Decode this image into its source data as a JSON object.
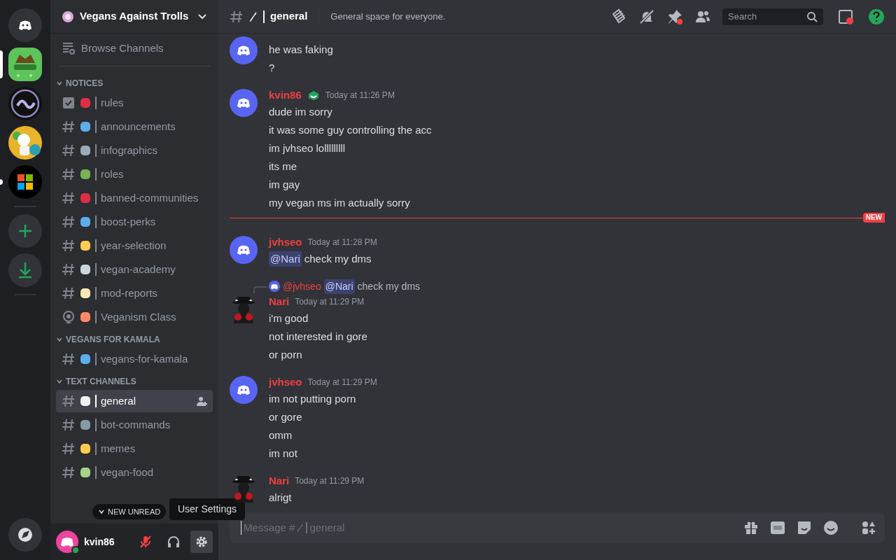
{
  "servers": [
    {
      "kind": "home",
      "selected": false,
      "unread": false
    },
    {
      "kind": "server",
      "selected": true,
      "unread": false
    },
    {
      "kind": "server",
      "selected": false,
      "unread": false
    },
    {
      "kind": "server",
      "selected": false,
      "unread": false
    },
    {
      "kind": "server",
      "selected": false,
      "unread": true
    },
    {
      "kind": "add",
      "selected": false,
      "unread": false
    },
    {
      "kind": "download",
      "selected": false,
      "unread": false
    },
    {
      "kind": "discover",
      "selected": false,
      "unread": false
    }
  ],
  "sidebar": {
    "server_name": "Vegans Against Trolls",
    "browse": "Browse Channels",
    "categories": [
      {
        "name": "NOTICES",
        "expanded": true,
        "channels": [
          {
            "kind": "rules",
            "name": "rules",
            "color": "#dd2e44",
            "selected": false
          },
          {
            "kind": "text",
            "name": "announcements",
            "color": "#5dadec",
            "selected": false
          },
          {
            "kind": "text",
            "name": "infographics",
            "color": "#9aaab8",
            "selected": false
          },
          {
            "kind": "text",
            "name": "roles",
            "color": "#77b255",
            "selected": false
          },
          {
            "kind": "text",
            "name": "banned-communities",
            "color": "#dd2e44",
            "selected": false
          },
          {
            "kind": "text",
            "name": "boost-perks",
            "color": "#5dadec",
            "selected": false
          },
          {
            "kind": "text",
            "name": "year-selection",
            "color": "#ffcc4d",
            "selected": false
          },
          {
            "kind": "text",
            "name": "vegan-academy",
            "color": "#ccd6dd",
            "selected": false
          },
          {
            "kind": "text",
            "name": "mod-reports",
            "color": "#ffe8b6",
            "selected": false
          },
          {
            "kind": "stage",
            "name": "Veganism Class",
            "color": "#ff8a65",
            "selected": false
          }
        ]
      },
      {
        "name": "VEGANS FOR KAMALA",
        "expanded": true,
        "channels": [
          {
            "kind": "text",
            "name": "vegans-for-kamala",
            "color": "#5dadec",
            "selected": false
          }
        ]
      },
      {
        "name": "TEXT CHANNELS",
        "expanded": true,
        "channels": [
          {
            "kind": "text",
            "name": "general",
            "color": "#f0f0f0",
            "selected": true
          },
          {
            "kind": "text",
            "name": "bot-commands",
            "color": "#8899a6",
            "selected": false
          },
          {
            "kind": "text",
            "name": "memes",
            "color": "#ffcc4d",
            "selected": false
          },
          {
            "kind": "text",
            "name": "vegan-food",
            "color": "#a6d388",
            "selected": false
          }
        ]
      }
    ],
    "new_unread": "NEW UNREAD"
  },
  "user": {
    "name": "kvin86",
    "muted": true,
    "tooltip": "User Settings"
  },
  "header": {
    "channel": "general",
    "topic": "General space for everyone.",
    "search": "Search"
  },
  "messages": [
    {
      "kind": "discord_avatar",
      "lines": [
        "he was faking",
        "?"
      ]
    },
    {
      "kind": "discord_avatar",
      "author": "kvin86",
      "badge": true,
      "time": "Today at 11:26 PM",
      "lines": [
        "dude im sorry",
        "it was some guy controlling the acc",
        "im jvhseo lolllllllll",
        "its me",
        "im gay",
        "my vegan ms im actually sorry"
      ]
    },
    {
      "kind": "divider",
      "divider": "NEW"
    },
    {
      "kind": "discord_avatar",
      "author": "jvhseo",
      "time": "Today at 11:28 PM",
      "mention": "@Nari",
      "lines": [
        "check my dms"
      ]
    },
    {
      "kind": "figure_avatar",
      "reply": {
        "author": "@jvhseo",
        "mention": "@Nari",
        "text": "check my dms"
      },
      "author": "Nari",
      "time": "Today at 11:29 PM",
      "lines": [
        "i'm good",
        "not interested in gore",
        "or porn"
      ]
    },
    {
      "kind": "discord_avatar",
      "author": "jvhseo",
      "time": "Today at 11:29 PM",
      "lines": [
        "im not putting porn",
        "or gore",
        "omm",
        "im not"
      ]
    },
    {
      "kind": "figure_avatar",
      "author": "Nari",
      "time": "Today at 11:29 PM",
      "lines": [
        "alrigt"
      ]
    }
  ],
  "composer": {
    "hint_prefix": "Message #",
    "hint_channel": "general"
  }
}
